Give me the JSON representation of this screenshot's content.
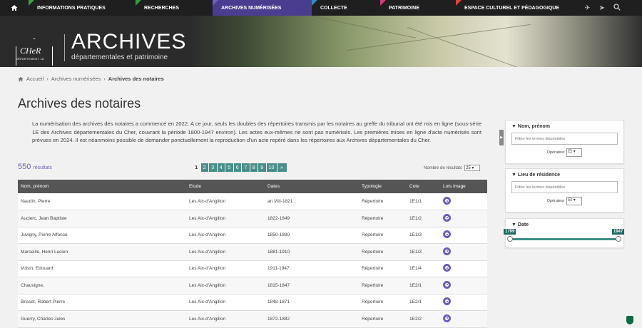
{
  "nav": {
    "items": [
      {
        "label": "INFORMATIONS PRATIQUES",
        "color": "#3aa33b",
        "width": 150
      },
      {
        "label": "RECHERCHES",
        "color": "#2f9d41",
        "width": 108
      },
      {
        "label": "ARCHIVES NUMÉRISÉES",
        "color": "#6e5fc0",
        "width": 139,
        "active": true
      },
      {
        "label": "COLLECTE",
        "color": "#2a8ec0",
        "width": 96
      },
      {
        "label": "PATRIMOINE",
        "color": "#d63a7a",
        "width": 106
      },
      {
        "label": "ESPACE CULTUREL ET PÉDAGOGIQUE",
        "color": "#e24040",
        "width": 160
      }
    ]
  },
  "banner": {
    "logo_text": "CHeR",
    "logo_sub": "DÉPARTEMENT 18",
    "title": "ARCHIVES",
    "subtitle": "départementales et patrimoine"
  },
  "breadcrumb": {
    "home": "Accueil",
    "level1": "Archives numérisées",
    "current": "Archives des notaires"
  },
  "page_title": "Archives des notaires",
  "intro": "La numérisation des archives des notaires a commencé en 2022. A ce jour, seuls les doubles des répertoires transmis par les notaires au greffe du tribunal ont été mis en ligne (sous-série 1E des Archives départementales du Cher, couvrant la période 1800-1947 environ). Les actes eux-mêmes ne sont pas numérisés. Les premières mises en ligne d'acte numérisés sont prévues en 2024. Il est néanmoins possible de demander ponctuellement la reproduction d'un acte repéré dans les répertoires aux Archives départementales du Cher.",
  "results": {
    "count": "550",
    "label": "résultats"
  },
  "pager": {
    "pages": [
      "1",
      "2",
      "3",
      "4",
      "5",
      "6",
      "7",
      "8",
      "9",
      "10"
    ],
    "next": "»"
  },
  "per_page": {
    "label": "Nombre de résultats",
    "value": "25"
  },
  "table": {
    "headers": [
      "Nom, prénom",
      "Etude",
      "Dates",
      "Typologie",
      "Cote",
      "Lots image"
    ],
    "rows": [
      [
        "Naudin, Pierre",
        "Les Aix-d'Angillon",
        "an VIII-1821",
        "Répertoire",
        "1E1/1"
      ],
      [
        "Auclerc, Jean Baptiste",
        "Les Aix-d'Angillon",
        "1822-1849",
        "Répertoire",
        "1E1/2"
      ],
      [
        "Juvigny, Pierre Alfonse",
        "Les Aix-d'Angillon",
        "1850-1880",
        "Répertoire",
        "1E1/3"
      ],
      [
        "Marseille, Henri Lucien",
        "Les Aix-d'Angillon",
        "1881-1910",
        "Répertoire",
        "1E1/3"
      ],
      [
        "Voisin, Edouard",
        "Les Aix-d'Angillon",
        "1911-1947",
        "Répertoire",
        "1E1/4"
      ],
      [
        "Chauvigne,",
        "Les Aix-d'Angillon",
        "1815-1847",
        "Répertoire",
        "1E2/1"
      ],
      [
        "Brisset, Robert Pierre",
        "Les Aix-d'Angillon",
        "1848-1871",
        "Répertoire",
        "1E2/1"
      ],
      [
        "Guerry, Charles Jules",
        "Les Aix-d'Angillon",
        "1872-1882",
        "Répertoire",
        "1E2/2"
      ]
    ]
  },
  "filters": {
    "name": {
      "title": "Nom, prénom",
      "placeholder": "Filtrer les termes disponibles",
      "op_label": "Opérateur",
      "op_value": "Et"
    },
    "residence": {
      "title": "Lieu de résidence",
      "placeholder": "Filtrer les termes disponibles",
      "op_label": "Opérateur",
      "op_value": "Et"
    },
    "date": {
      "title": "Date",
      "min": "1799",
      "max": "1947"
    }
  }
}
